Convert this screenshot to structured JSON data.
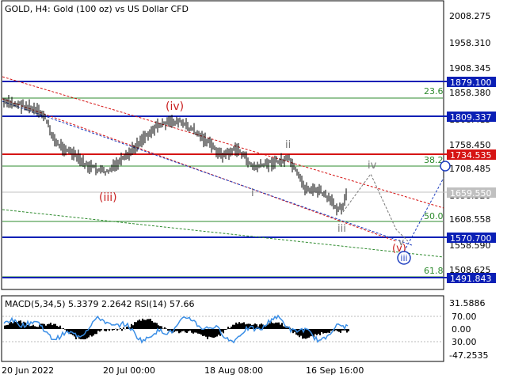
{
  "header": {
    "symbol_line": "GOLD, H4:  Gold (100 oz) vs US Dollar CFD"
  },
  "price_axis": {
    "ticks": [
      "2008.275",
      "1958.310",
      "1908.345",
      "1858.380",
      "1808.415",
      "1758.450",
      "1708.485",
      "1658.520",
      "1608.558",
      "1558.590",
      "1508.625"
    ],
    "levels": [
      {
        "label": "1879.100",
        "color": "#0a1fb5",
        "kind": "blue"
      },
      {
        "label": "1809.337",
        "color": "#0a1fb5",
        "kind": "blue"
      },
      {
        "label": "1734.535",
        "color": "#d61414",
        "kind": "red"
      },
      {
        "label": "1659.550",
        "color": "#c0c0c0",
        "kind": "gray"
      },
      {
        "label": "1570.700",
        "color": "#0a1fb5",
        "kind": "blue"
      },
      {
        "label": "1491.843",
        "color": "#0a1fb5",
        "kind": "blue"
      }
    ],
    "fib_levels": [
      "23.6",
      "38.2",
      "50.0",
      "61.8"
    ]
  },
  "wave_labels": {
    "iii_paren": "(iii)",
    "iv_paren": "(iv)",
    "v_paren": "(v)",
    "ii_roman": "ii",
    "i_roman": "i",
    "iii_roman": "iii",
    "iv_projection": "iv",
    "v_projection": "v",
    "iii_circle": "iii"
  },
  "indicator": {
    "legend": "MACD(5,34,5) 5.3379 2.2642 RSI(14) 57.66",
    "ticks": [
      "31.5886",
      "70.00",
      "0.00",
      "30.00",
      "-47.2535"
    ]
  },
  "time_axis": {
    "labels": [
      "20 Jun 2022",
      "20 Jul 00:00",
      "18 Aug 08:00",
      "16 Sep 16:00"
    ]
  },
  "colors": {
    "blue_level": "#0a1fb5",
    "red_level": "#d61414",
    "fib_green": "#2e8b2e",
    "candle": "#000000",
    "rsi_line": "#3a8ee6",
    "wave_red": "#c81e1e",
    "wave_gray": "#777777",
    "wave_blue": "#1f3fc0"
  }
}
